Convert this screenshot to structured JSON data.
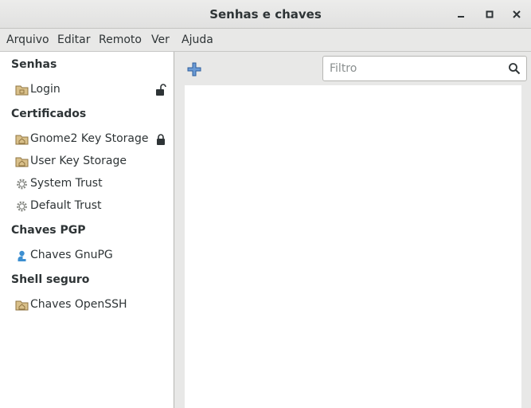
{
  "window": {
    "title": "Senhas e chaves"
  },
  "menu": [
    "Arquivo",
    "Editar",
    "Remoto",
    "Ver",
    "Ajuda"
  ],
  "sidebar": {
    "sections": [
      {
        "title": "Senhas",
        "items": [
          {
            "label": "Login",
            "icon": "folder-icon",
            "locked": true
          }
        ]
      },
      {
        "title": "Certificados",
        "items": [
          {
            "label": "Gnome2 Key Storage",
            "icon": "folder-icon",
            "locked": true
          },
          {
            "label": "User Key Storage",
            "icon": "folder-icon",
            "locked": false
          },
          {
            "label": "System Trust",
            "icon": "gear-icon",
            "locked": false
          },
          {
            "label": "Default Trust",
            "icon": "gear-icon",
            "locked": false
          }
        ]
      },
      {
        "title": "Chaves PGP",
        "items": [
          {
            "label": "Chaves GnuPG",
            "icon": "person-key-icon",
            "locked": false
          }
        ]
      },
      {
        "title": "Shell seguro",
        "items": [
          {
            "label": "Chaves OpenSSH",
            "icon": "folder-icon",
            "locked": false
          }
        ]
      }
    ]
  },
  "toolbar": {
    "filter_placeholder": "Filtro"
  },
  "colors": {
    "accent": "#3465a4",
    "folder": "#c4a000"
  }
}
